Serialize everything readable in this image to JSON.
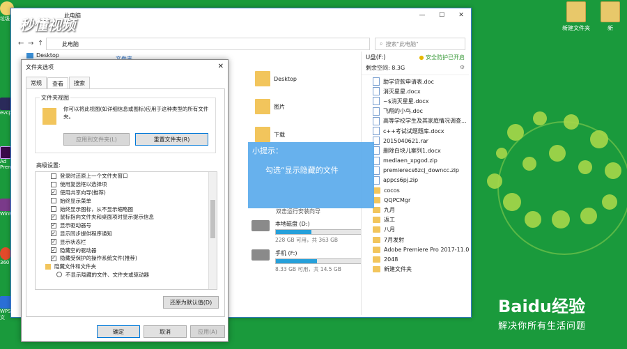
{
  "watermark": {
    "logo_text": "秒懂视频"
  },
  "desktop_icons": [
    {
      "label": "新建文件夹"
    },
    {
      "label": "新"
    }
  ],
  "leftbar_labels": [
    "垃圾",
    "evcp",
    "Ad",
    "Prem",
    "WinR",
    "360",
    "WPS文"
  ],
  "explorer": {
    "title": "此电脑",
    "address": "此电脑",
    "search_placeholder": "搜索\"此电脑\"",
    "nav_desktop": "Desktop",
    "nav_partial": "文件夹",
    "folders": [
      {
        "name": "Desktop"
      },
      {
        "name": "图片"
      },
      {
        "name": "下载"
      }
    ],
    "partial_label": "双击运行安装向导",
    "drives": [
      {
        "name": "本地磁盘 (D:)",
        "usage": "228 GB 可用，共 363 GB",
        "fill": 0.37
      },
      {
        "name": "手机 (F:)",
        "usage": "8.33 GB 可用，共 14.5 GB",
        "fill": 0.43
      }
    ]
  },
  "upane": {
    "title": "U盘(F:)",
    "security": "安全防护已开启",
    "free": "剩余空间: 8.3G",
    "items": [
      {
        "name": "助学贷款申请表.doc",
        "kind": "file"
      },
      {
        "name": "消灭星星.docx",
        "kind": "file"
      },
      {
        "name": "~$消灭星星.docx",
        "kind": "file"
      },
      {
        "name": "飞翔的小鸟.doc",
        "kind": "file"
      },
      {
        "name": "高等学校学生及其家庭情况调查...",
        "kind": "file"
      },
      {
        "name": "c++考试试题题库.docx",
        "kind": "file"
      },
      {
        "name": "2015040621.rar",
        "kind": "file"
      },
      {
        "name": "删除白块儿案列1.docx",
        "kind": "file"
      },
      {
        "name": "mediaen_xpgod.zip",
        "kind": "file"
      },
      {
        "name": "premierecs6zcj_downcc.zip",
        "kind": "file"
      },
      {
        "name": "appcs6pj.zip",
        "kind": "file"
      },
      {
        "name": "cocos",
        "kind": "folder"
      },
      {
        "name": "QQPCMgr",
        "kind": "folder"
      },
      {
        "name": "九月",
        "kind": "folder"
      },
      {
        "name": "返工",
        "kind": "folder"
      },
      {
        "name": "八月",
        "kind": "folder"
      },
      {
        "name": "7月发射",
        "kind": "folder"
      },
      {
        "name": "Adobe Premiere Pro 2017-11.0",
        "kind": "folder"
      },
      {
        "name": "2048",
        "kind": "folder"
      },
      {
        "name": "新建文件夹",
        "kind": "folder"
      }
    ]
  },
  "dialog": {
    "title": "文件夹选项",
    "tabs": [
      "常规",
      "查看",
      "搜索"
    ],
    "group_title": "文件夹视图",
    "group_desc": "你可以将此视图(如详细信息或图标)应用于这种类型的所有文件夹。",
    "apply_btn": "应用到文件夹(L)",
    "reset_btn": "重置文件夹(R)",
    "advanced_label": "高级设置:",
    "options": [
      {
        "label": "登录时还原上一个文件夹窗口",
        "checked": false
      },
      {
        "label": "使用复选框以选择项",
        "checked": false
      },
      {
        "label": "使用共享向导(推荐)",
        "checked": true
      },
      {
        "label": "始终显示菜单",
        "checked": false
      },
      {
        "label": "始终显示图标，从不显示缩略图",
        "checked": false
      },
      {
        "label": "鼠标指向文件夹和桌面项时显示提示信息",
        "checked": true
      },
      {
        "label": "显示驱动器号",
        "checked": true
      },
      {
        "label": "显示同步提供程序通知",
        "checked": true
      },
      {
        "label": "显示状态栏",
        "checked": true
      },
      {
        "label": "隐藏空的驱动器",
        "checked": true
      },
      {
        "label": "隐藏受保护的操作系统文件(推荐)",
        "checked": true
      },
      {
        "label": "隐藏文件和文件夹",
        "checked": null
      },
      {
        "label": "不显示隐藏的文件、文件夹或驱动器",
        "checked": null
      }
    ],
    "restore_btn": "还原为默认值(D)",
    "ok": "确定",
    "cancel": "取消",
    "apply": "应用(A)"
  },
  "tip": {
    "title": "小提示：",
    "text": "勾选“显示隐藏的文件"
  },
  "baidu": {
    "logo": "Baidu经验",
    "slogan": "解决你所有生活问题"
  },
  "colors": {
    "desktop_bg": "#1a9a3c",
    "accent": "#0078d7",
    "tip_bg": "#5aaaeb"
  }
}
